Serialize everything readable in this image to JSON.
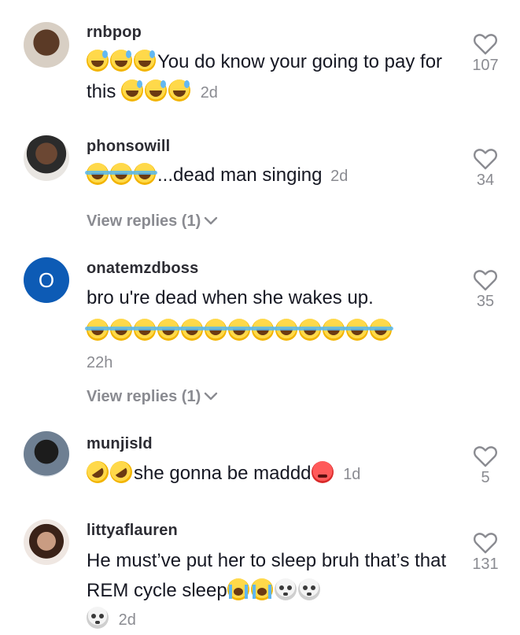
{
  "comments": [
    {
      "username": "rnbpop",
      "text_before": "You do know your going to pay for this ",
      "time": "2d",
      "likes": "107",
      "avatar_icon": "user-avatar-photo"
    },
    {
      "username": "phonsowill",
      "text_before": "...dead man singing",
      "time": "2d",
      "likes": "34",
      "avatar_icon": "user-avatar-photo",
      "replies_label": "View replies (1)"
    },
    {
      "username": "onatemzdboss",
      "avatar_letter": "O",
      "text_before": "bro u're dead when she wakes up.",
      "time": "22h",
      "likes": "35",
      "replies_label": "View replies (1)"
    },
    {
      "username": "munjisld",
      "text_before": "she gonna be maddd",
      "time": "1d",
      "likes": "5",
      "avatar_icon": "user-avatar-photo"
    },
    {
      "username": "littyaflauren",
      "text_before": "He must’ve put her to sleep bruh that’s that REM cycle sleep",
      "time": "2d",
      "likes": "131",
      "avatar_icon": "user-avatar-photo"
    }
  ],
  "colors": {
    "primary_text": "#161823",
    "secondary_text": "#8a8b91",
    "avatar_blue": "#0d5bb5"
  }
}
